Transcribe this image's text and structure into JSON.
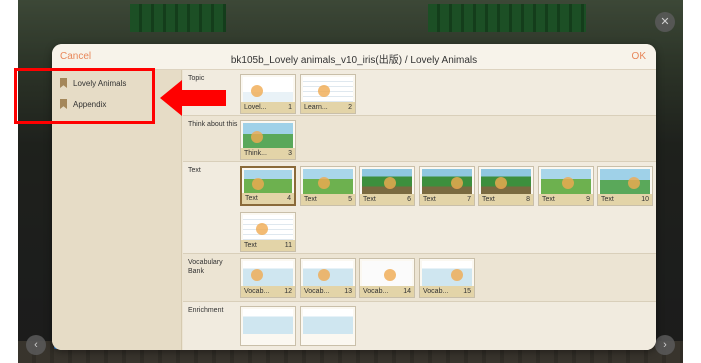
{
  "dialog": {
    "cancel_label": "Cancel",
    "title": "bk105b_Lovely animals_v10_iris(出版) / Lovely Animals",
    "ok_label": "OK"
  },
  "sidebar": {
    "items": [
      {
        "label": "Lovely Animals"
      },
      {
        "label": "Appendix"
      }
    ]
  },
  "sections": [
    {
      "label": "Topic",
      "pages": [
        {
          "name": "Lovel...",
          "num": "1",
          "thumb": "t-white"
        },
        {
          "name": "Learn...",
          "num": "2",
          "thumb": "t-list"
        }
      ]
    },
    {
      "label": "Think about this",
      "pages": [
        {
          "name": "Think...",
          "num": "3",
          "thumb": "t-green"
        }
      ]
    },
    {
      "label": "Text",
      "pages": [
        {
          "name": "Text",
          "num": "4",
          "thumb": "t-zoo"
        },
        {
          "name": "Text",
          "num": "5",
          "thumb": "t-zoo"
        },
        {
          "name": "Text",
          "num": "6",
          "thumb": "t-jungle"
        },
        {
          "name": "Text",
          "num": "7",
          "thumb": "t-jungle"
        },
        {
          "name": "Text",
          "num": "8",
          "thumb": "t-jungle"
        },
        {
          "name": "Text",
          "num": "9",
          "thumb": "t-zoo"
        },
        {
          "name": "Text",
          "num": "10",
          "thumb": "t-green"
        },
        {
          "name": "Text",
          "num": "11",
          "thumb": "t-list"
        }
      ]
    },
    {
      "label": "Vocabulary Bank",
      "pages": [
        {
          "name": "Vocab...",
          "num": "12",
          "thumb": "t-vocab"
        },
        {
          "name": "Vocab...",
          "num": "13",
          "thumb": "t-vocab"
        },
        {
          "name": "Vocab...",
          "num": "14",
          "thumb": "t-blank"
        },
        {
          "name": "Vocab...",
          "num": "15",
          "thumb": "t-vocab"
        }
      ]
    },
    {
      "label": "Enrichment",
      "pages": []
    }
  ],
  "colors": {
    "accent": "#e8875a",
    "annotation": "#ff0000",
    "bookmark": "#a4875a"
  },
  "icons": {
    "close": "close-icon",
    "prev": "chevron-left-icon",
    "next": "chevron-right-icon"
  }
}
